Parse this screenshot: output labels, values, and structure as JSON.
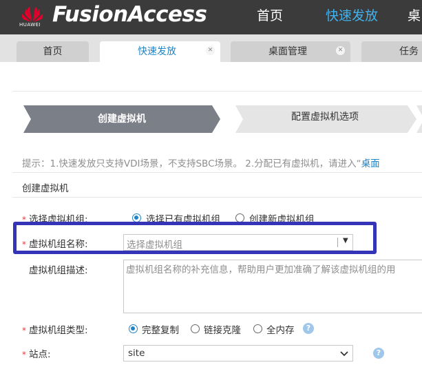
{
  "header": {
    "logo_text": "HUAWEI",
    "brand": "FusionAccess",
    "nav": [
      {
        "label": "首页"
      },
      {
        "label": "快速发放",
        "active": true
      },
      {
        "label": "桌"
      }
    ]
  },
  "tabs": [
    {
      "label": "首页"
    },
    {
      "label": "快速发放",
      "active": true,
      "closable": true
    },
    {
      "label": "桌面管理",
      "closable": true
    },
    {
      "label": "任务"
    }
  ],
  "wizard": {
    "steps": [
      {
        "label": "创建虚拟机",
        "active": true
      },
      {
        "label": "配置虚拟机选项",
        "active": false
      }
    ]
  },
  "hint": {
    "text": "提示：1.快速发放只支持VDI场景，不支持SBC场景。  2.分配已有虚拟机，请进入“",
    "link": "桌面"
  },
  "section_title": "创建虚拟机",
  "form": {
    "vm_group_select": {
      "label": "选择虚拟机组:",
      "required": true,
      "options": [
        {
          "label": "选择已有虚拟机组",
          "checked": true
        },
        {
          "label": "创建新虚拟机组",
          "checked": false
        }
      ]
    },
    "vm_group_name": {
      "label": "虚拟机组名称:",
      "required": true,
      "placeholder": "选择虚拟机组"
    },
    "vm_group_desc": {
      "label": "虚拟机组描述:",
      "placeholder": "虚拟机组名称的补充信息，帮助用户更加准确了解该虚拟机组的用"
    },
    "vm_group_type": {
      "label": "虚拟机组类型:",
      "required": true,
      "options": [
        {
          "label": "完整复制",
          "checked": true
        },
        {
          "label": "链接克隆",
          "checked": false
        },
        {
          "label": "全内存",
          "checked": false
        }
      ],
      "help": "?"
    },
    "site": {
      "label": "站点:",
      "required": true,
      "value": "site",
      "help": "?"
    }
  },
  "colors": {
    "header_bg": "#3b3b3b",
    "nav_active": "#3fb2f0",
    "accent": "#1f85c8",
    "step_active": "#7b7f88",
    "step_inactive": "#e5e5e5",
    "required": "#e43a2f",
    "highlight_box": "#3434b8"
  }
}
